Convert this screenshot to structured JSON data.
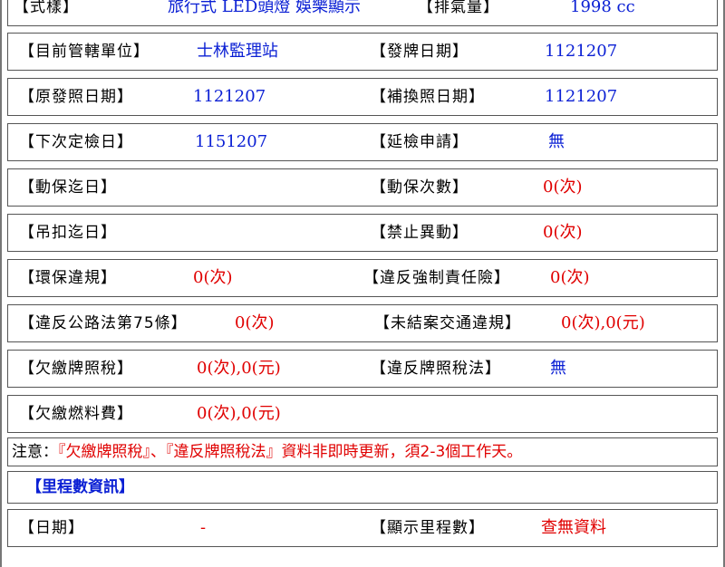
{
  "rows": [
    {
      "l1": "【式樣】",
      "v1": "旅行式 LED頭燈 娛樂顯示",
      "l2": "【排氣量】",
      "v2": "1998 cc"
    },
    {
      "l1": "【目前管轄單位】",
      "v1": "士林監理站",
      "l2": "【發牌日期】",
      "v2": "1121207"
    },
    {
      "l1": "【原發照日期】",
      "v1": "1121207",
      "l2": "【補換照日期】",
      "v2": "1121207"
    },
    {
      "l1": "【下次定檢日】",
      "v1": "1151207",
      "l2": "【延檢申請】",
      "v2": "無"
    },
    {
      "l1": "【動保迄日】",
      "v1": "",
      "l2": "【動保次數】",
      "v2": "0(次)"
    },
    {
      "l1": "【吊扣迄日】",
      "v1": "",
      "l2": "【禁止異動】",
      "v2": "0(次)"
    },
    {
      "l1": "【環保違規】",
      "v1": "0(次)",
      "l2": "【違反強制責任險】",
      "v2": "0(次)"
    },
    {
      "l1": "【違反公路法第75條】",
      "v1": "0(次)",
      "l2": "【未結案交通違規】",
      "v2": "0(次),0(元)"
    },
    {
      "l1": "【欠繳牌照稅】",
      "v1": "0(次),0(元)",
      "l2": "【違反牌照稅法】",
      "v2": "無"
    },
    {
      "l1": "【欠繳燃料費】",
      "v1": "0(次),0(元)",
      "l2": "",
      "v2": ""
    }
  ],
  "notice": {
    "label": "注意：",
    "text": "『欠繳牌照稅』、『違反牌照稅法』資料非即時更新，須2-3個工作天。"
  },
  "mileage_section": {
    "title": "【里程數資訊】",
    "date_label": "【日期】",
    "date_value": "-",
    "mileage_label": "【顯示里程數】",
    "mileage_value": "查無資料"
  },
  "colors": {
    "value_blue": "#0a1fd4",
    "value_red": "#e00000",
    "border": "#555555"
  }
}
